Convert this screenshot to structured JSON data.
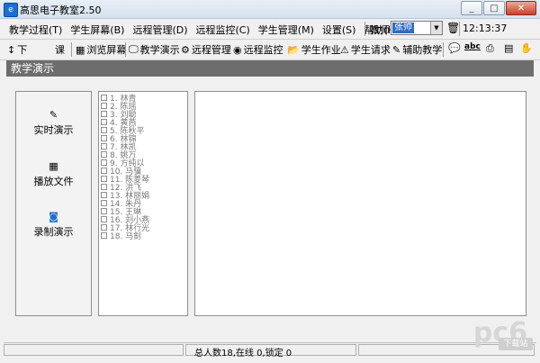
{
  "window": {
    "title": "高思电子教室2.50",
    "min": "_",
    "max": "□",
    "close": "✕"
  },
  "menu": [
    {
      "label": "教学过程(T)"
    },
    {
      "label": "学生屏幕(B)"
    },
    {
      "label": "远程管理(D)"
    },
    {
      "label": "远程监控(C)"
    },
    {
      "label": "学生管理(M)"
    },
    {
      "label": "设置(S)"
    },
    {
      "label": "帮助(H)"
    }
  ],
  "header_right": {
    "teacher_label": "教师",
    "teacher_value": "张帅",
    "time": "12:13:37"
  },
  "toolbar": {
    "items": [
      {
        "label": "下",
        "icon": "↕"
      },
      {
        "label": "课",
        "icon": ""
      },
      {
        "label": "浏览屏幕",
        "icon": "▦"
      },
      {
        "label": "教学演示",
        "icon": "🖵"
      },
      {
        "label": "远程管理",
        "icon": "⚙"
      },
      {
        "label": "远程监控",
        "icon": "◉"
      },
      {
        "label": "学生作业",
        "icon": "📂"
      },
      {
        "label": "学生请求",
        "icon": "⚠"
      },
      {
        "label": "辅助教学",
        "icon": "✎"
      }
    ],
    "right_icons": [
      "chat-icon",
      "abc-icon",
      "printer-icon",
      "book-icon",
      "hand-icon"
    ]
  },
  "section": {
    "title": "教学演示"
  },
  "left_nav": [
    {
      "label": "实时演示",
      "icon": "pen-icon"
    },
    {
      "label": "播放文件",
      "icon": "film-icon"
    },
    {
      "label": "录制演示",
      "icon": "record-icon"
    }
  ],
  "students": [
    "1. 林青",
    "2. 陈瑶",
    "3. 刘聪",
    "4. 黄燕",
    "5. 陈秋平",
    "6. 林锦",
    "7. 林凯",
    "8. 姚万",
    "9. 方纯以",
    "10. 马骥",
    "11. 陈菱琴",
    "12. 洪飞",
    "13. 林丽娟",
    "14. 朱丹",
    "15. 王琳",
    "16. 刘小燕",
    "17. 林行光",
    "18. 马釗"
  ],
  "status": {
    "text": "总人数18,在线 0,锁定 0"
  },
  "watermark": {
    "text": "pc6",
    "badge": "下载站"
  }
}
